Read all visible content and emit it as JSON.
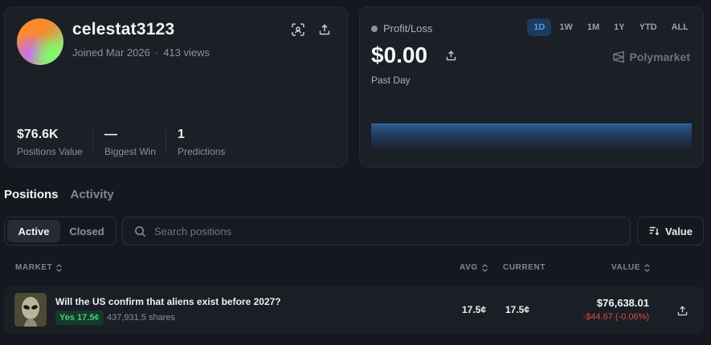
{
  "profile": {
    "username": "celestat3123",
    "joined": "Joined Mar 2026",
    "separator": "·",
    "views": "413 views",
    "stats": [
      {
        "value": "$76.6K",
        "label": "Positions Value"
      },
      {
        "value": "—",
        "label": "Biggest Win"
      },
      {
        "value": "1",
        "label": "Predictions"
      }
    ]
  },
  "pnl": {
    "label": "Profit/Loss",
    "value": "$0.00",
    "period_label": "Past Day",
    "periods": [
      "1D",
      "1W",
      "1M",
      "1Y",
      "YTD",
      "ALL"
    ],
    "active_period": "1D",
    "brand": "Polymarket"
  },
  "tabs": {
    "positions": "Positions",
    "activity": "Activity",
    "active": "Positions"
  },
  "filters": {
    "active": "Active",
    "closed": "Closed",
    "search_placeholder": "Search positions",
    "sort_label": "Value"
  },
  "table": {
    "headers": {
      "market": "MARKET",
      "avg": "AVG",
      "current": "CURRENT",
      "value": "VALUE"
    },
    "rows": [
      {
        "question": "Will the US confirm that aliens exist before 2027?",
        "outcome": "Yes 17.5¢",
        "shares": "437,931.5 shares",
        "avg": "17.5¢",
        "current": "17.5¢",
        "value": "$76,638.01",
        "change": "-$44.67 (-0.06%)"
      }
    ]
  },
  "colors": {
    "background": "#15191f",
    "card": "#1b1f26",
    "accent_blue": "#4c9bf0",
    "positive": "#3fcf7b",
    "negative": "#e0484d"
  }
}
